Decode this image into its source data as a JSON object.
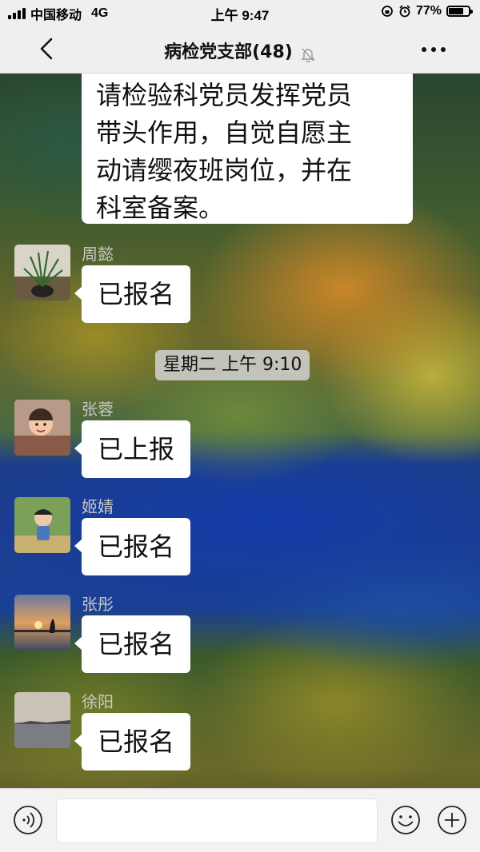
{
  "status_bar": {
    "carrier": "中国移动",
    "network": "4G",
    "time": "上午 9:47",
    "battery": "77%",
    "battery_level": 0.77
  },
  "nav": {
    "title": "病检党支部(48)",
    "icons": [
      "back-arrow-icon",
      "mute-bell-icon",
      "more-icon"
    ]
  },
  "messages": {
    "first": {
      "text": "请检验科党员发挥党员带头作用，自觉自愿主动请缨夜班岗位，并在科室备案。",
      "lines": [
        "请检验科党员发挥党员",
        "带头作用，自觉自愿主",
        "动请缨夜班岗位，并在",
        "科室备案。"
      ]
    },
    "m1": {
      "sender": "周懿",
      "text": "已报名"
    },
    "timestamp": "星期二 上午 9:10",
    "m2": {
      "sender": "张蓉",
      "text": "已上报"
    },
    "m3": {
      "sender": "姬婧",
      "text": "已报名"
    },
    "m4": {
      "sender": "张彤",
      "text": "已报名"
    },
    "m5": {
      "sender": "徐阳",
      "text": "已报名"
    }
  },
  "input_bar": {
    "message_value": "",
    "icons": [
      "voice-icon",
      "emoji-icon",
      "plus-icon"
    ]
  }
}
